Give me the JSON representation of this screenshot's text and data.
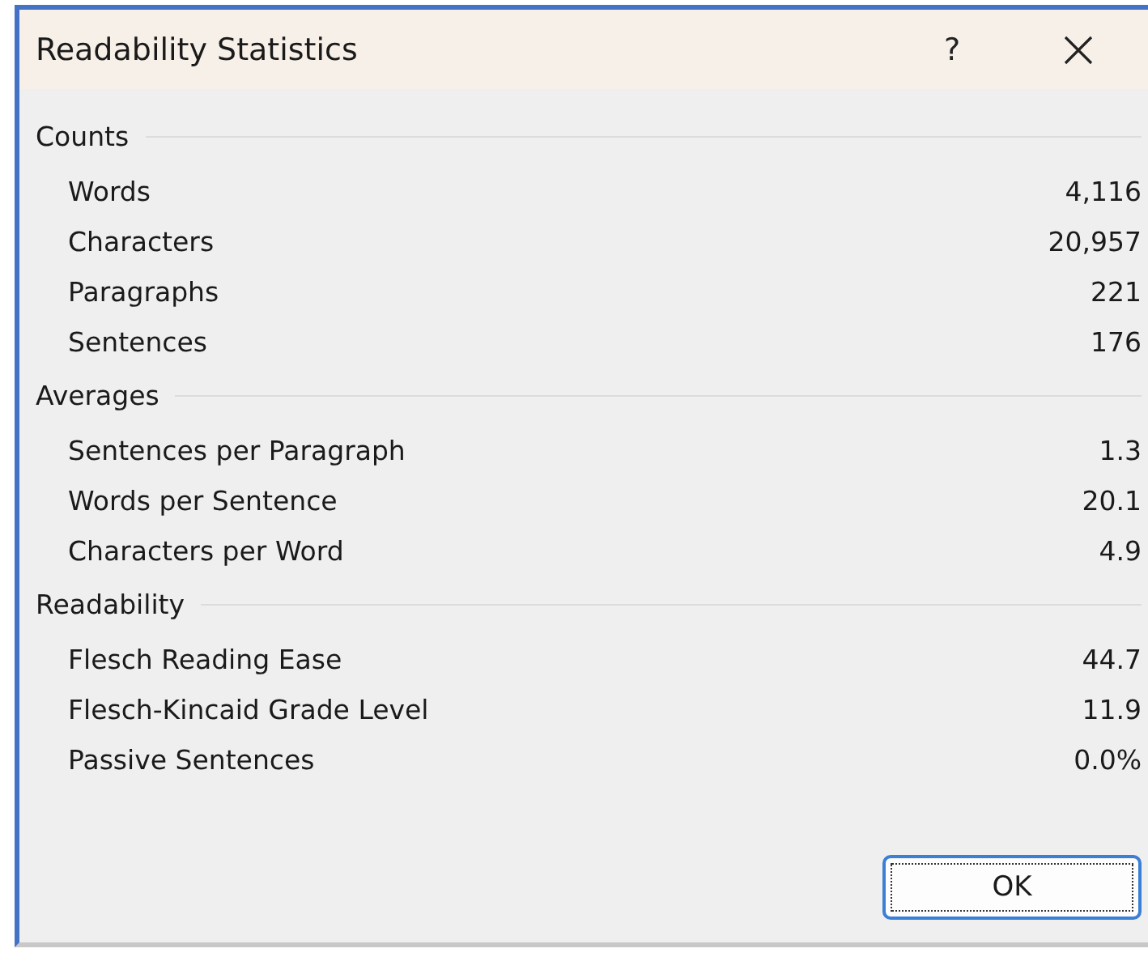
{
  "window": {
    "title": "Readability Statistics",
    "help": "?"
  },
  "sections": [
    {
      "title": "Counts",
      "rows": [
        {
          "label": "Words",
          "value": "4,116"
        },
        {
          "label": "Characters",
          "value": "20,957"
        },
        {
          "label": "Paragraphs",
          "value": "221"
        },
        {
          "label": "Sentences",
          "value": "176"
        }
      ]
    },
    {
      "title": "Averages",
      "rows": [
        {
          "label": "Sentences per Paragraph",
          "value": "1.3"
        },
        {
          "label": "Words per Sentence",
          "value": "20.1"
        },
        {
          "label": "Characters per Word",
          "value": "4.9"
        }
      ]
    },
    {
      "title": "Readability",
      "rows": [
        {
          "label": "Flesch Reading Ease",
          "value": "44.7"
        },
        {
          "label": "Flesch-Kincaid Grade Level",
          "value": "11.9"
        },
        {
          "label": "Passive Sentences",
          "value": "0.0%"
        }
      ]
    }
  ],
  "buttons": [
    "OK"
  ]
}
